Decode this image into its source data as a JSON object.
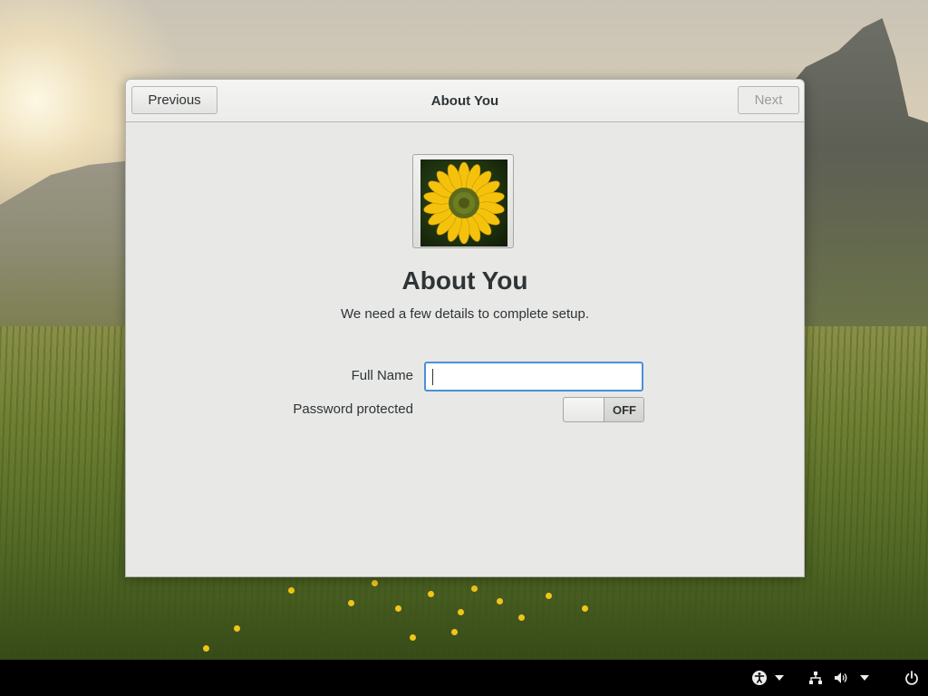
{
  "header": {
    "previous_label": "Previous",
    "title": "About You",
    "next_label": "Next"
  },
  "page": {
    "heading": "About You",
    "subtitle": "We need a few details to complete setup."
  },
  "form": {
    "full_name_label": "Full Name",
    "full_name_value": "",
    "password_label": "Password protected",
    "password_switch_state": "OFF"
  },
  "avatar": {
    "icon": "sunflower-avatar"
  },
  "panel": {
    "icons": [
      "accessibility-icon",
      "chevron-down-icon",
      "network-icon",
      "volume-icon",
      "chevron-down-icon",
      "power-icon"
    ]
  },
  "colors": {
    "focus_accent": "#4a90d9",
    "dialog_bg": "#e8e8e7",
    "text": "#2e3436",
    "panel_bg": "#000000"
  }
}
